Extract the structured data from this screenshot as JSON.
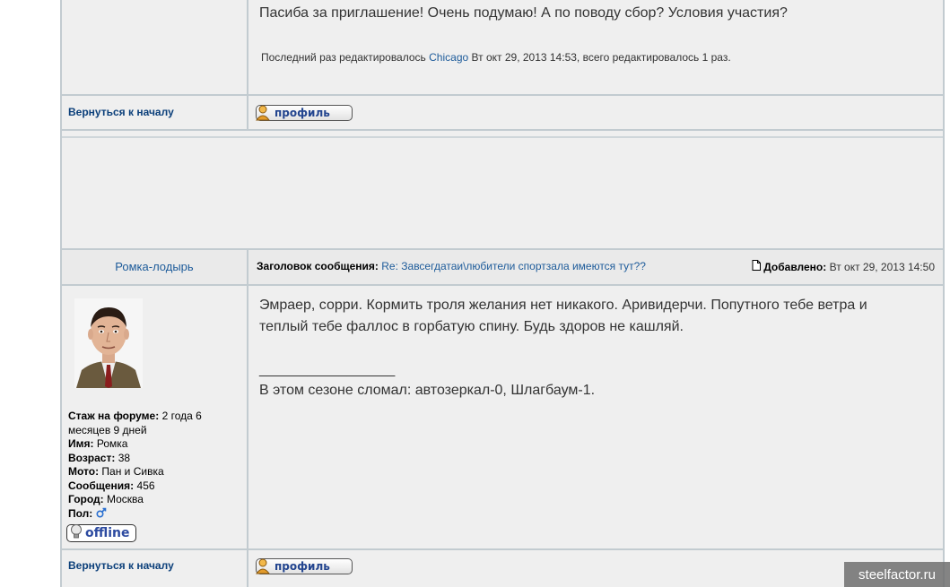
{
  "prev_post": {
    "message": "Пасиба за приглашение! Очень подумаю! А по поводу сбор? Условия участия?",
    "edit_prefix": "Последний раз редактировалось",
    "edit_user": "Chicago",
    "edit_suffix": "Вт окт 29, 2013 14:53, всего редактировалось 1 раз.",
    "back_to_top": "Вернуться к началу",
    "profile_label": "профиль"
  },
  "post": {
    "author": "Ромка-лодырь",
    "subject_label": "Заголовок сообщения:",
    "subject": "Re: Завсегдатаи\\любители спортзала имеются тут??",
    "added_label": "Добавлено:",
    "added_date": "Вт окт 29, 2013 14:50",
    "message_line1": "Эмраер, сорри. Кормить троля желания нет никакого. Аривидерчи. Попутного тебе ветра и",
    "message_line2": "теплый тебе фаллос в горбатую спину. Будь здоров не кашляй.",
    "signature_sep": "_________________",
    "signature": "В этом сезоне сломал: автозеркал-0, Шлагбаум-1.",
    "profile": {
      "stazh_label": "Стаж на форуме:",
      "stazh_value_1": "2 года 6",
      "stazh_value_2": "месяцев 9 дней",
      "name_label": "Имя:",
      "name_value": "Ромка",
      "age_label": "Возраст:",
      "age_value": "38",
      "moto_label": "Мото:",
      "moto_value": "Пан и Сивка",
      "posts_label": "Сообщения:",
      "posts_value": "456",
      "city_label": "Город:",
      "city_value": "Москва",
      "gender_label": "Пол:",
      "gender_icon": "male-symbol-icon",
      "status": "offline"
    },
    "back_to_top": "Вернуться к началу",
    "profile_label": "профиль"
  },
  "watermark": "steelfactor.ru",
  "colors": {
    "link": "#1d5b9a",
    "back_link": "#0b3f7a",
    "border": "#c2cbd0",
    "background": "#efefef"
  }
}
